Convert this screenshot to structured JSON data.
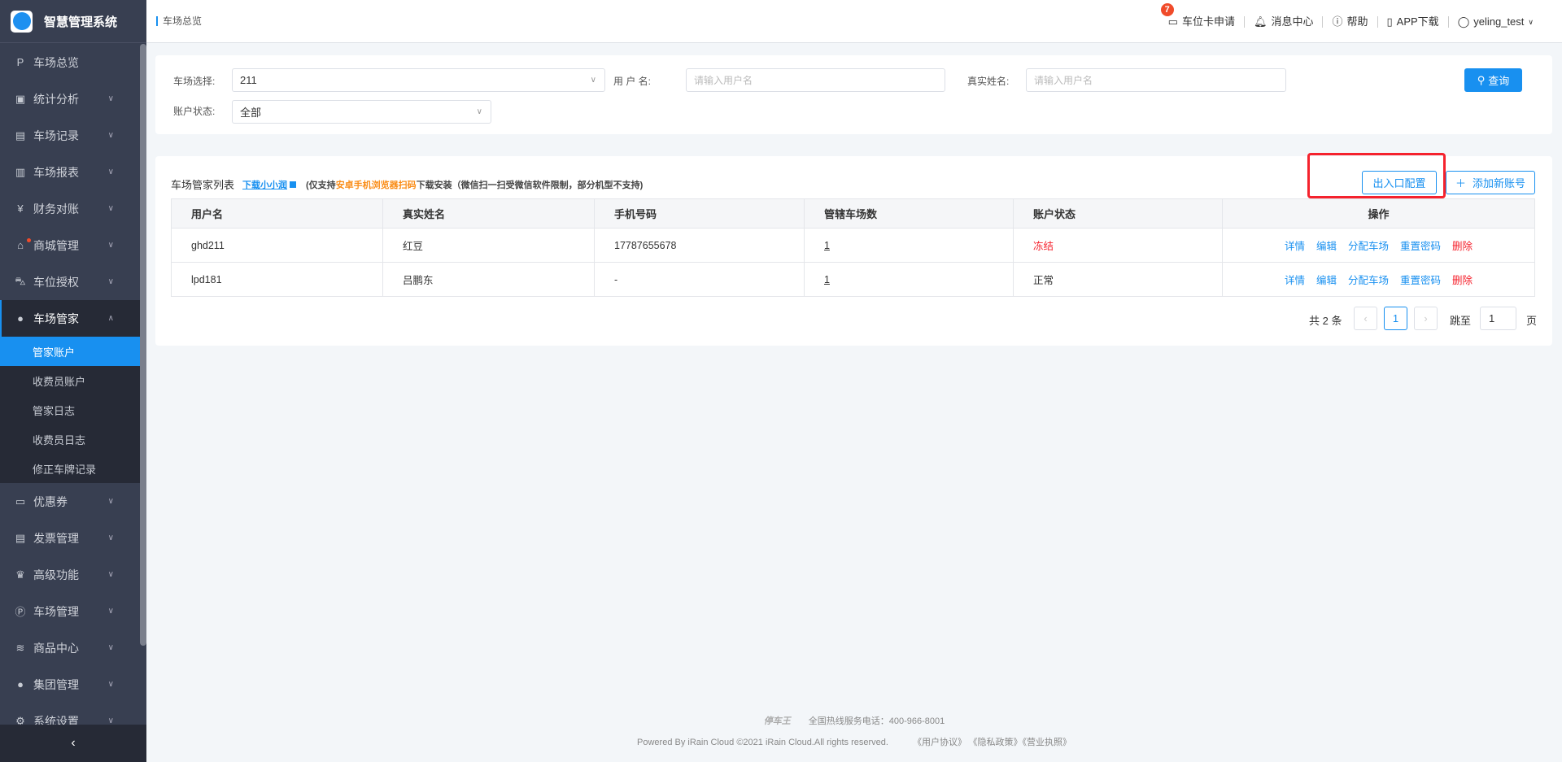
{
  "app": {
    "title": "智慧管理系统"
  },
  "sidebar": {
    "items": [
      {
        "label": "车场总览",
        "icon": "parking-icon"
      },
      {
        "label": "统计分析",
        "icon": "monitor-icon"
      },
      {
        "label": "车场记录",
        "icon": "file-icon"
      },
      {
        "label": "车场报表",
        "icon": "report-icon"
      },
      {
        "label": "财务对账",
        "icon": "money-icon"
      },
      {
        "label": "商城管理",
        "icon": "shop-icon"
      },
      {
        "label": "车位授权",
        "icon": "car-icon"
      },
      {
        "label": "车场管家",
        "icon": "user-icon"
      },
      {
        "label": "优惠券",
        "icon": "coupon-icon"
      },
      {
        "label": "发票管理",
        "icon": "invoice-icon"
      },
      {
        "label": "高级功能",
        "icon": "crown-icon"
      },
      {
        "label": "车场管理",
        "icon": "p-circle-icon"
      },
      {
        "label": "商品中心",
        "icon": "layers-icon"
      },
      {
        "label": "集团管理",
        "icon": "group-icon"
      },
      {
        "label": "系统设置",
        "icon": "gear-icon"
      }
    ],
    "sub": [
      "管家账户",
      "收费员账户",
      "管家日志",
      "收费员日志",
      "修正车牌记录"
    ]
  },
  "header": {
    "breadcrumb": "车场总览",
    "card_apply": "车位卡申请",
    "card_badge": "7",
    "messages": "消息中心",
    "help": "帮助",
    "app": "APP下载",
    "user": "yeling_test"
  },
  "filter": {
    "lot_label": "车场选择:",
    "lot_value": "211",
    "user_label": "用 户 名:",
    "user_placeholder": "请输入用户名",
    "real_label": "真实姓名:",
    "real_placeholder": "请输入用户名",
    "status_label": "账户状态:",
    "status_value": "全部",
    "search": "查询"
  },
  "list": {
    "title": "车场管家列表",
    "download": "下载小小润",
    "note_pre": "(仅支持",
    "note_hl": "安卓手机浏览器扫码",
    "note_post": "下载安装（微信扫一扫受微信软件限制，部分机型不支持)",
    "config_btn": "出入口配置",
    "add_btn": "添加新账号",
    "columns": [
      "用户名",
      "真实姓名",
      "手机号码",
      "管辖车场数",
      "账户状态",
      "操作"
    ],
    "rows": [
      {
        "user": "ghd211",
        "name": "红豆",
        "phone": "17787655678",
        "lots": "1",
        "status": "冻结"
      },
      {
        "user": "lpd181",
        "name": "吕鹏东",
        "phone": "-",
        "lots": "1",
        "status": "正常"
      }
    ],
    "ops": [
      "详情",
      "编辑",
      "分配车场",
      "重置密码",
      "删除"
    ],
    "total": "共 2 条",
    "page": "1",
    "jump": "跳至",
    "jump_value": "1",
    "page_suffix": "页"
  },
  "footer": {
    "brand": "停车王",
    "hotline": "全国热线服务电话：400-966-8001",
    "copyright": "Powered By iRain Cloud ©2021 iRain Cloud.All rights reserved.",
    "links": [
      "《用户协议》",
      "《隐私政策》",
      "《营业执照》"
    ]
  },
  "colors": {
    "primary": "#1890f0",
    "danger": "#f5222d",
    "sidebar": "#383f51"
  }
}
